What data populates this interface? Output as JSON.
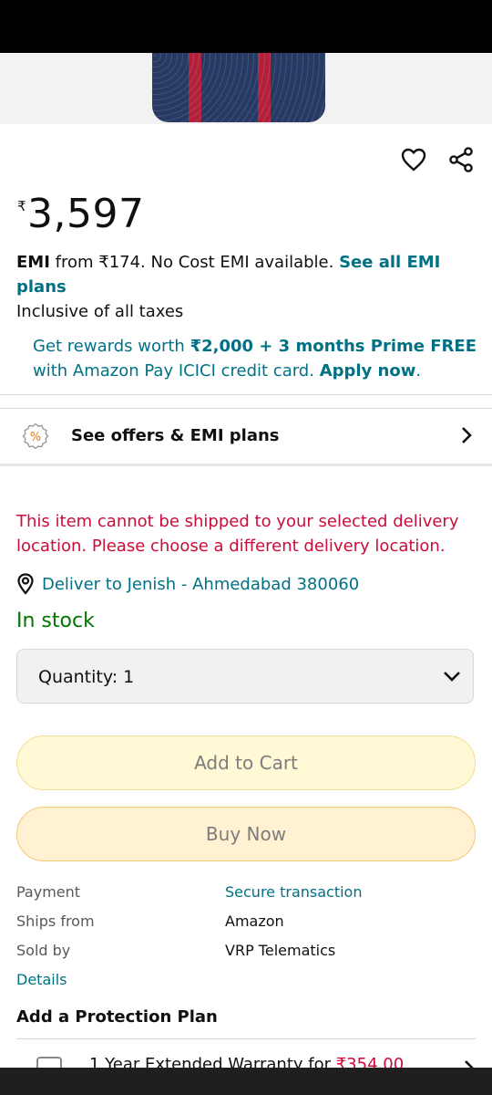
{
  "actions": {
    "wishlist_icon": "heart-icon",
    "share_icon": "share-icon"
  },
  "price": {
    "symbol": "₹",
    "value": "3,597"
  },
  "emi": {
    "label": "EMI",
    "text": " from ₹174. No Cost EMI available. ",
    "link": "See all EMI plans"
  },
  "taxes": "Inclusive of all taxes",
  "rewards": {
    "p1": "Get rewards worth ",
    "amount": "₹2,000 + 3 months Prime FREE",
    "p2": " with Amazon Pay ICICI credit card. ",
    "cta": "Apply now",
    "end": "."
  },
  "offers": {
    "label": "See offers & EMI plans"
  },
  "shipping_warning": "This item cannot be shipped to your selected delivery location. Please choose a different delivery location.",
  "delivery": {
    "text": "Deliver to Jenish - Ahmedabad 380060"
  },
  "stock": "In stock",
  "quantity": {
    "label": "Quantity:",
    "value": "1"
  },
  "buttons": {
    "add_to_cart": "Add to Cart",
    "buy_now": "Buy Now"
  },
  "info": {
    "payment_label": "Payment",
    "payment_value": "Secure transaction",
    "ships_label": "Ships from",
    "ships_value": "Amazon",
    "sold_label": "Sold by",
    "sold_value": "VRP Telematics",
    "details": "Details"
  },
  "protection": {
    "title": "Add a Protection Plan",
    "partial_text": "1 Year Extended Warranty for ",
    "partial_price": "₹354.00"
  },
  "colors": {
    "link": "#007185",
    "warning": "#cc0c39",
    "stock": "#007600"
  }
}
